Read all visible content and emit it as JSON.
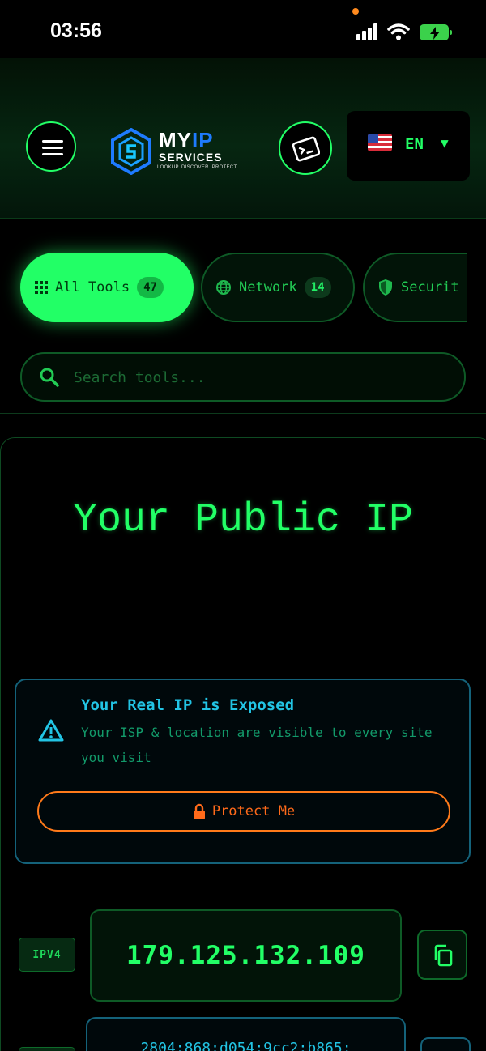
{
  "status_bar": {
    "time": "03:56"
  },
  "header": {
    "logo": {
      "main_my": "MY",
      "main_ip": "IP",
      "sub": "SERVICES",
      "tagline": "LOOKUP. DISCOVER. PROTECT"
    },
    "language": {
      "code": "EN",
      "caret": "▼"
    }
  },
  "tabs": [
    {
      "label": "All Tools",
      "count": "47",
      "active": true
    },
    {
      "label": "Network",
      "count": "14",
      "active": false
    },
    {
      "label": "Securit",
      "active": false
    }
  ],
  "search": {
    "placeholder": "Search tools..."
  },
  "hero": {
    "title": "Your Public IP"
  },
  "alert": {
    "title": "Your Real IP is Exposed",
    "text": "Your ISP & location are visible to every site you visit",
    "button_label": "Protect Me"
  },
  "ipv4": {
    "label": "IPV4",
    "value": "179.125.132.109"
  },
  "ipv6": {
    "value": "2804:868:d054:9cc2:b865:"
  },
  "colors": {
    "accent": "#22ff66",
    "info": "#22c4e4",
    "warning": "#ff7a1a"
  }
}
